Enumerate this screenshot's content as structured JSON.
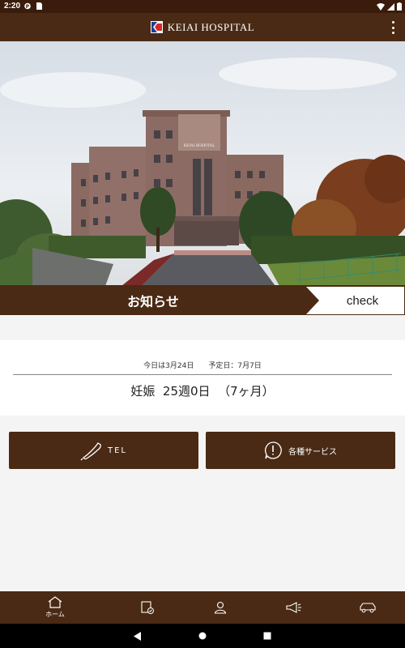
{
  "status_bar": {
    "time": "2:20"
  },
  "app_bar": {
    "title": "KEIAI HOSPITAL",
    "logo_icon": "hospital-logo",
    "menu_icon": "more-vert-icon"
  },
  "hero": {
    "image": "hospital-building-photo",
    "building_sign": "KEIAI HOSPITAL"
  },
  "news": {
    "label": "お知らせ",
    "check_label": "check"
  },
  "pregnancy": {
    "today": "今日は3月24日",
    "due": "予定日：7月7日",
    "status": "妊娠  25週0日  （7ヶ月）"
  },
  "actions": {
    "tel_label": "TEL",
    "services_label": "各種サービス"
  },
  "bottom_nav": [
    {
      "label": "ホーム",
      "icon": "home-icon"
    },
    {
      "label": "",
      "icon": "checklist-icon"
    },
    {
      "label": "",
      "icon": "person-icon"
    },
    {
      "label": "",
      "icon": "megaphone-icon"
    },
    {
      "label": "",
      "icon": "car-icon"
    }
  ],
  "colors": {
    "brand_brown": "#4a2a14",
    "status_bar": "#3a1c0c",
    "background": "#f4f4f4"
  }
}
